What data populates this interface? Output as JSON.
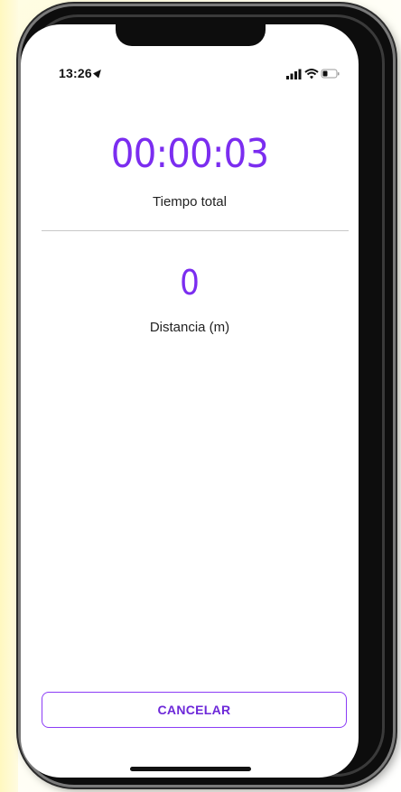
{
  "status_bar": {
    "time": "13:26",
    "icons": [
      "location-arrow-icon",
      "signal-icon",
      "wifi-icon",
      "battery-icon"
    ]
  },
  "timer": {
    "value": "00:00:03",
    "label": "Tiempo total"
  },
  "distance": {
    "value": "0",
    "label": "Distancia (m)"
  },
  "actions": {
    "cancel_label": "CANCELAR"
  },
  "colors": {
    "accent": "#7b2df0",
    "button_border": "#8b3cf6",
    "text": "#222222",
    "divider": "#c8c8c8"
  }
}
